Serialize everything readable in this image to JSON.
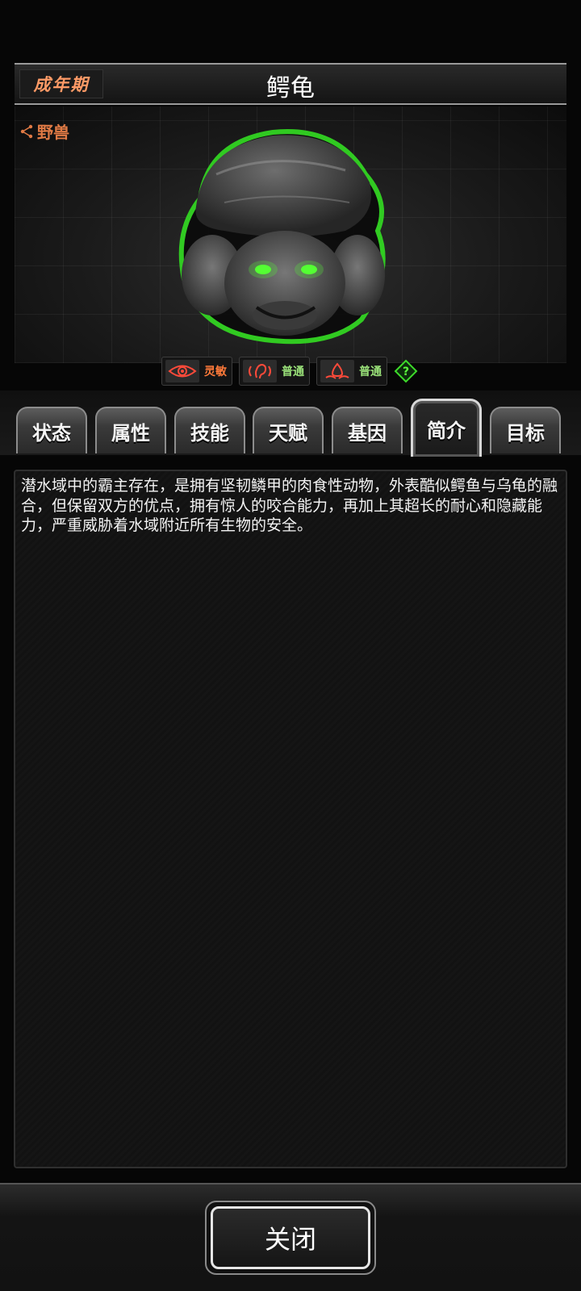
{
  "header": {
    "stage_badge": "成年期",
    "title": "鳄龟"
  },
  "portrait": {
    "category": "野兽",
    "creature_icon": "snapping-turtle-portrait"
  },
  "traits": [
    {
      "icon": "eye-icon",
      "label": "灵敏",
      "color": "#ff7a3a"
    },
    {
      "icon": "ear-icon",
      "label": "普通",
      "color": "#9be37a"
    },
    {
      "icon": "smell-icon",
      "label": "普通",
      "color": "#9be37a"
    }
  ],
  "help_icon": "question-diamond-icon",
  "tabs": [
    {
      "label": "状态",
      "active": false
    },
    {
      "label": "属性",
      "active": false
    },
    {
      "label": "技能",
      "active": false
    },
    {
      "label": "天赋",
      "active": false
    },
    {
      "label": "基因",
      "active": false
    },
    {
      "label": "简介",
      "active": true
    },
    {
      "label": "目标",
      "active": false
    }
  ],
  "description": "潜水域中的霸主存在，是拥有坚韧鳞甲的肉食性动物，外表酷似鳄鱼与乌龟的融合，但保留双方的优点，拥有惊人的咬合能力，再加上其超长的耐心和隐藏能力，严重威胁着水域附近所有生物的安全。",
  "footer": {
    "close_label": "关闭"
  }
}
